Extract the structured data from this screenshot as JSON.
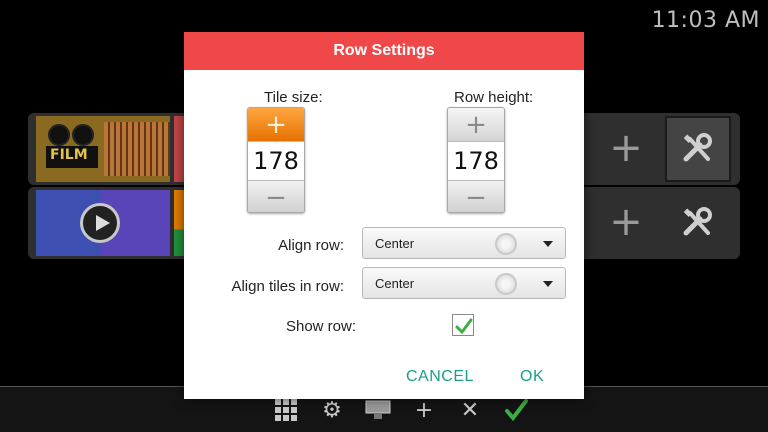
{
  "status": {
    "clock": "11:03 AM"
  },
  "background": {
    "row1_tile_text": "FILM"
  },
  "dialog": {
    "title": "Row Settings",
    "tile_size": {
      "label": "Tile size:",
      "value": "178",
      "plus": "+",
      "minus": "−"
    },
    "row_height": {
      "label": "Row height:",
      "value": "178",
      "plus": "+",
      "minus": "−"
    },
    "align_row": {
      "label": "Align row:",
      "value": "Center"
    },
    "align_tiles": {
      "label": "Align tiles in row:",
      "value": "Center"
    },
    "show_row": {
      "label": "Show row:",
      "checked": true
    },
    "cancel": "CANCEL",
    "ok": "OK"
  },
  "colors": {
    "header": "#f04848",
    "accent_orange": "#ff8c1a",
    "action_teal": "#1b9e8a",
    "check_green": "#3cb043"
  },
  "bottom_bar": {
    "icons": [
      "grid-icon",
      "gear-icon",
      "tile-add-icon",
      "plus-icon",
      "tools-icon",
      "check-icon"
    ]
  }
}
